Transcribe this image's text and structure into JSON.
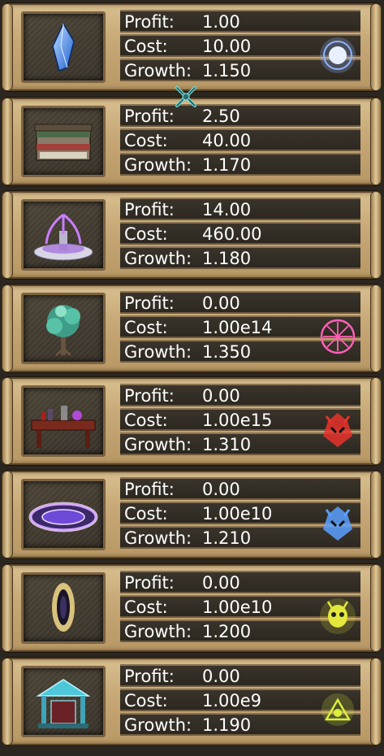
{
  "labels": {
    "profit": "Profit:",
    "cost": "Cost:",
    "growth": "Growth:"
  },
  "buildings": [
    {
      "icon": "blue-crystal-icon",
      "profit": "1.00",
      "cost": "10.00",
      "growth": "1.150",
      "badge": "blue-orb-rune-icon",
      "badge_color": "#8fb4ff"
    },
    {
      "icon": "treasure-chest-icon",
      "profit": "2.50",
      "cost": "40.00",
      "growth": "1.170",
      "badge": null,
      "badge_color": null
    },
    {
      "icon": "purple-fountain-icon",
      "profit": "14.00",
      "cost": "460.00",
      "growth": "1.180",
      "badge": null,
      "badge_color": null
    },
    {
      "icon": "crystal-tree-icon",
      "profit": "0.00",
      "cost": "1.00e14",
      "growth": "1.350",
      "badge": "pink-sigil-icon",
      "badge_color": "#ff5fb8"
    },
    {
      "icon": "alchemy-table-icon",
      "profit": "0.00",
      "cost": "1.00e15",
      "growth": "1.310",
      "badge": "red-demon-mask-icon",
      "badge_color": "#e8322a"
    },
    {
      "icon": "summoning-circle-icon",
      "profit": "0.00",
      "cost": "1.00e10",
      "growth": "1.210",
      "badge": "blue-demon-mask-icon",
      "badge_color": "#5aa0ff"
    },
    {
      "icon": "dark-portal-icon",
      "profit": "0.00",
      "cost": "1.00e10",
      "growth": "1.200",
      "badge": "yellow-skull-icon",
      "badge_color": "#e4e83a"
    },
    {
      "icon": "glowing-shrine-icon",
      "profit": "0.00",
      "cost": "1.00e9",
      "growth": "1.190",
      "badge": "yellow-glyph-icon",
      "badge_color": "#d8ef3c"
    }
  ]
}
